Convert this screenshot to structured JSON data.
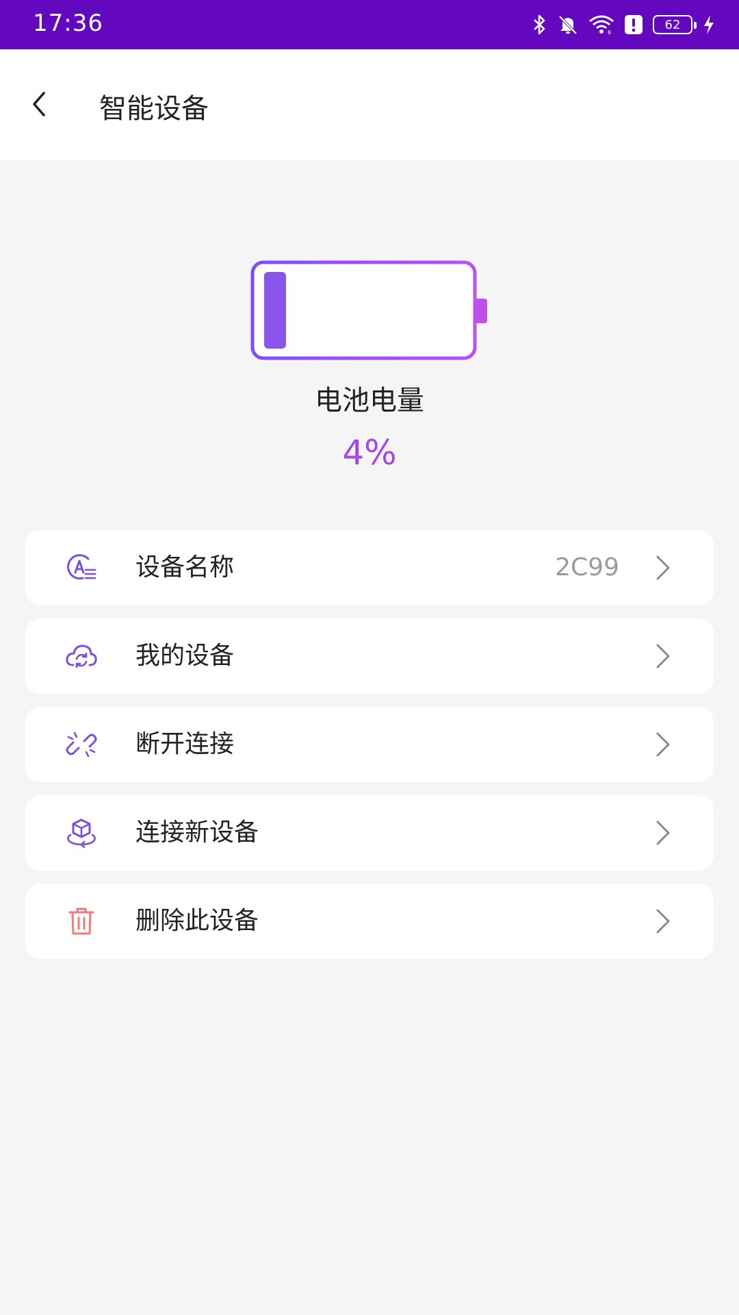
{
  "status_bar": {
    "time": "17:36",
    "battery_level": "62",
    "icons": [
      "bluetooth-icon",
      "bell-muted-icon",
      "wifi-icon",
      "alert-icon",
      "battery-icon",
      "charging-icon"
    ]
  },
  "header": {
    "title": "智能设备",
    "back_icon": "chevron-left-icon"
  },
  "battery": {
    "label": "电池电量",
    "value": "4%",
    "level_fraction": 0.04,
    "gradient_colors": [
      "#7c4dff",
      "#c04ff0"
    ]
  },
  "menu": {
    "items": [
      {
        "label": "设备名称",
        "value": "2C99",
        "icon": "device-name-icon",
        "icon_color": "#7a4fe0"
      },
      {
        "label": "我的设备",
        "value": "",
        "icon": "cloud-sync-icon",
        "icon_color": "#7a4fe0"
      },
      {
        "label": "断开连接",
        "value": "",
        "icon": "unlink-icon",
        "icon_color": "#7a4fe0"
      },
      {
        "label": "连接新设备",
        "value": "",
        "icon": "cube-connect-icon",
        "icon_color": "#7a4fe0"
      },
      {
        "label": "删除此设备",
        "value": "",
        "icon": "trash-icon",
        "icon_color": "#f07a7a"
      }
    ],
    "chevron_icon": "chevron-right-icon"
  },
  "colors": {
    "status_bar": "#6308bf",
    "accent": "#a845e8",
    "background": "#f5f5f5"
  }
}
